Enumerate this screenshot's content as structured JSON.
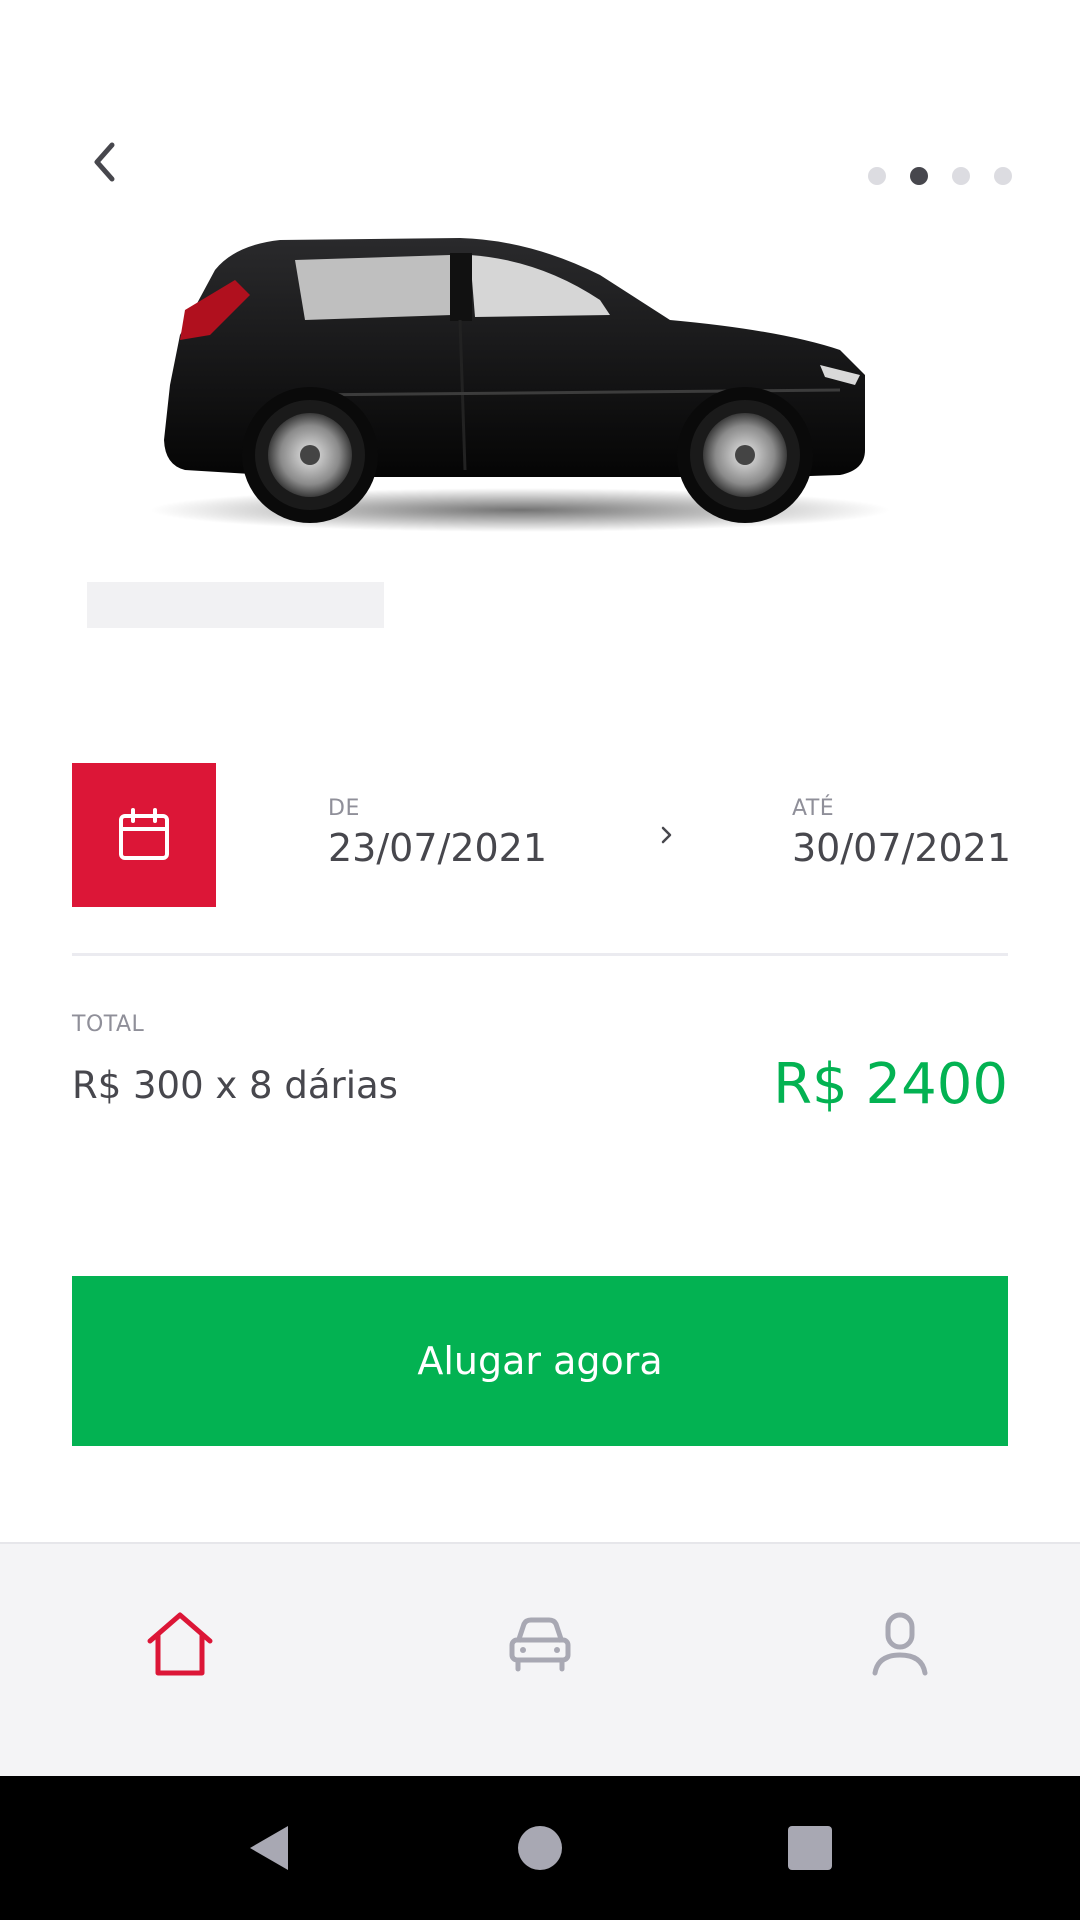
{
  "carousel": {
    "count": 4,
    "active_index": 1
  },
  "colors": {
    "accent_red": "#dc1637",
    "accent_green": "#03b252",
    "text": "#47474d",
    "muted": "#8f8f99"
  },
  "period": {
    "from_label": "DE",
    "from_date": "23/07/2021",
    "to_label": "ATÉ",
    "to_date": "30/07/2021"
  },
  "total": {
    "label": "TOTAL",
    "rate_text": "R$ 300 x 8 dárias",
    "value_text": "R$ 2400"
  },
  "actions": {
    "rent_label": "Alugar agora"
  },
  "tabbar": {
    "active": "home",
    "items": [
      {
        "id": "home",
        "icon": "home-icon"
      },
      {
        "id": "cars",
        "icon": "car-icon"
      },
      {
        "id": "profile",
        "icon": "user-icon"
      }
    ]
  },
  "system_nav": {
    "icons": [
      "back-triangle-icon",
      "home-circle-icon",
      "recents-square-icon"
    ]
  }
}
